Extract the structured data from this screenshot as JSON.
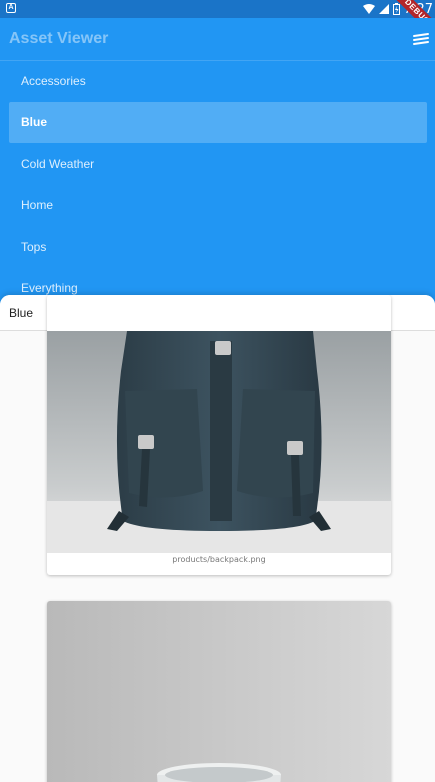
{
  "status_bar": {
    "time": "7:27",
    "debug_label": "DEBUG"
  },
  "app_bar": {
    "title": "Asset Viewer",
    "menu_icon": "menu-icon"
  },
  "categories": [
    {
      "label": "Accessories",
      "selected": false
    },
    {
      "label": "Blue",
      "selected": true
    },
    {
      "label": "Cold Weather",
      "selected": false
    },
    {
      "label": "Home",
      "selected": false
    },
    {
      "label": "Tops",
      "selected": false
    },
    {
      "label": "Everything",
      "selected": false
    }
  ],
  "sheet": {
    "title": "Blue",
    "assets": [
      {
        "caption": "products/backpack.png",
        "subject": "backpack"
      },
      {
        "caption": "",
        "subject": "cup"
      }
    ]
  },
  "colors": {
    "primary": "#2196f3",
    "status_bar": "#1a74c8",
    "debug_banner": "#b3262b"
  }
}
